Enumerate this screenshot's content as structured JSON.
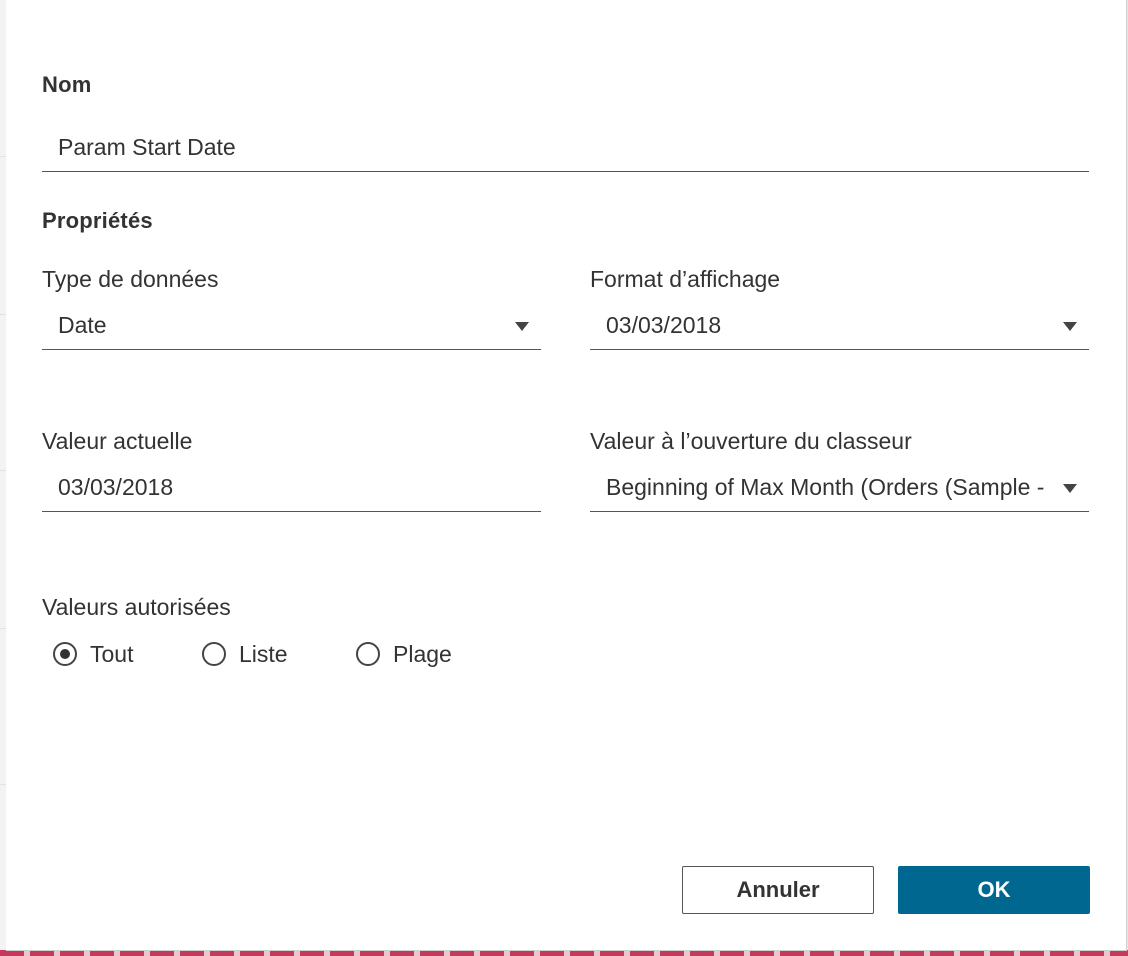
{
  "dialog": {
    "name_section": {
      "title": "Nom",
      "value": "Param Start Date"
    },
    "properties_section": {
      "title": "Propriétés",
      "data_type": {
        "label": "Type de données",
        "value": "Date"
      },
      "display_format": {
        "label": "Format d’affichage",
        "value": "03/03/2018"
      },
      "current_value": {
        "label": "Valeur actuelle",
        "value": "03/03/2018"
      },
      "value_on_open": {
        "label": "Valeur à l’ouverture du classeur",
        "value": "Beginning of Max Month (Orders (Sample - Superstore))"
      },
      "allowed_values": {
        "label": "Valeurs autorisées",
        "options": [
          {
            "label": "Tout",
            "checked": true
          },
          {
            "label": "Liste",
            "checked": false
          },
          {
            "label": "Plage",
            "checked": false
          }
        ]
      }
    },
    "buttons": {
      "cancel": "Annuler",
      "ok": "OK"
    },
    "colors": {
      "accent": "#006890",
      "text": "#333333"
    }
  }
}
